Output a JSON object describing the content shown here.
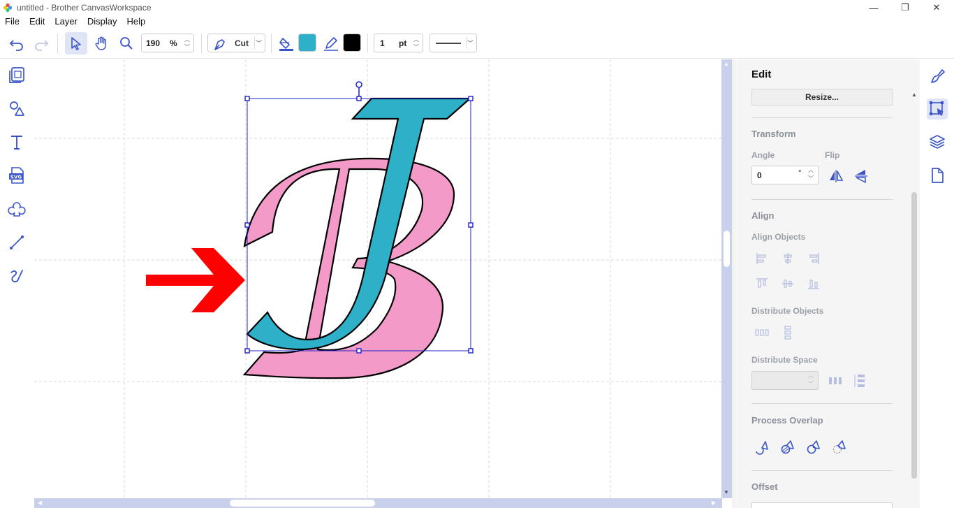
{
  "window": {
    "title": "untitled - Brother CanvasWorkspace",
    "minimize_glyph": "—",
    "restore_glyph": "❐",
    "close_glyph": "✕"
  },
  "menu": [
    "File",
    "Edit",
    "Layer",
    "Display",
    "Help"
  ],
  "toolbar": {
    "zoom_value": "190",
    "zoom_unit": "%",
    "mode_label": "Cut",
    "fill_color": "#2eb0c8",
    "line_color": "#000000",
    "line_width_value": "1",
    "line_width_unit": "pt"
  },
  "left_tools": [
    "document-icon",
    "shapes-icon",
    "text-icon",
    "svg-icon",
    "pattern-icon",
    "line-icon",
    "freehand-icon"
  ],
  "right_panel": {
    "title": "Edit",
    "resize_label": "Resize...",
    "transform": {
      "section": "Transform",
      "angle_label": "Angle",
      "angle_value": "0",
      "angle_unit": "°",
      "flip_label": "Flip"
    },
    "align": {
      "section": "Align",
      "align_objects_label": "Align Objects",
      "distribute_objects_label": "Distribute Objects",
      "distribute_space_label": "Distribute Space"
    },
    "process_overlap": {
      "section": "Process Overlap"
    },
    "offset": {
      "section": "Offset"
    }
  },
  "colors": {
    "accent": "#3a55c8",
    "pink": "#f49ac8",
    "teal": "#2eb0c8",
    "arrow_red": "#ff0000"
  }
}
